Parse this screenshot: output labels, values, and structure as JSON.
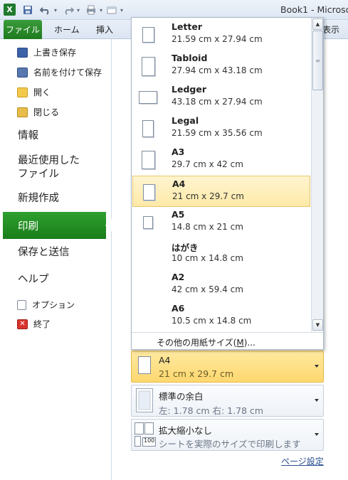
{
  "titlebar": {
    "logo": "X",
    "title": "Book1 - Microso",
    "icons": [
      "save-icon",
      "undo-icon",
      "redo-icon",
      "print-preview-icon",
      "customize-icon"
    ]
  },
  "ribbon": {
    "tabs": [
      "ファイル",
      "ホーム",
      "挿入",
      "表示"
    ]
  },
  "nav": {
    "small_top": [
      {
        "label": "上書き保存",
        "icon": "save-icon"
      },
      {
        "label": "名前を付けて保存",
        "icon": "save-as-icon"
      },
      {
        "label": "開く",
        "icon": "folder-open-icon"
      },
      {
        "label": "閉じる",
        "icon": "folder-close-icon"
      }
    ],
    "info": "情報",
    "recent_line1": "最近使用した",
    "recent_line2": "ファイル",
    "new": "新規作成",
    "print": "印刷",
    "save_send": "保存と送信",
    "help": "ヘルプ",
    "options": "オプション",
    "exit": "終了"
  },
  "paper_list": {
    "items": [
      {
        "name": "Letter",
        "size": "21.59 cm x 27.94 cm",
        "selected": false
      },
      {
        "name": "Tabloid",
        "size": "27.94 cm x 43.18 cm",
        "selected": false
      },
      {
        "name": "Ledger",
        "size": "43.18 cm x 27.94 cm",
        "selected": false
      },
      {
        "name": "Legal",
        "size": "21.59 cm x 35.56 cm",
        "selected": false
      },
      {
        "name": "A3",
        "size": "29.7 cm x 42 cm",
        "selected": false
      },
      {
        "name": "A4",
        "size": "21 cm x 29.7 cm",
        "selected": true
      },
      {
        "name": "A5",
        "size": "14.8 cm x 21 cm",
        "selected": false
      },
      {
        "name": "はがき",
        "size": "10 cm x 14.8 cm",
        "selected": false
      },
      {
        "name": "A2",
        "size": "42 cm x 59.4 cm",
        "selected": false
      },
      {
        "name": "A6",
        "size": "10.5 cm x 14.8 cm",
        "selected": false
      }
    ],
    "more_label": "その他の用紙サイズ(",
    "more_key": "M",
    "more_suffix": ")..."
  },
  "selectors": {
    "paper": {
      "title": "A4",
      "subtitle": "21 cm x 29.7 cm"
    },
    "margins": {
      "title": "標準の余白",
      "subtitle": "左:  1.78 cm    右:  1.78 cm"
    },
    "scaling": {
      "title": "拡大縮小なし",
      "subtitle": "シートを実際のサイズで印刷します",
      "badge": "100"
    }
  },
  "page_setup_link": "ページ設定",
  "colors": {
    "accent_green": "#1e7a1e",
    "highlight_yellow": "#fde9a8"
  }
}
